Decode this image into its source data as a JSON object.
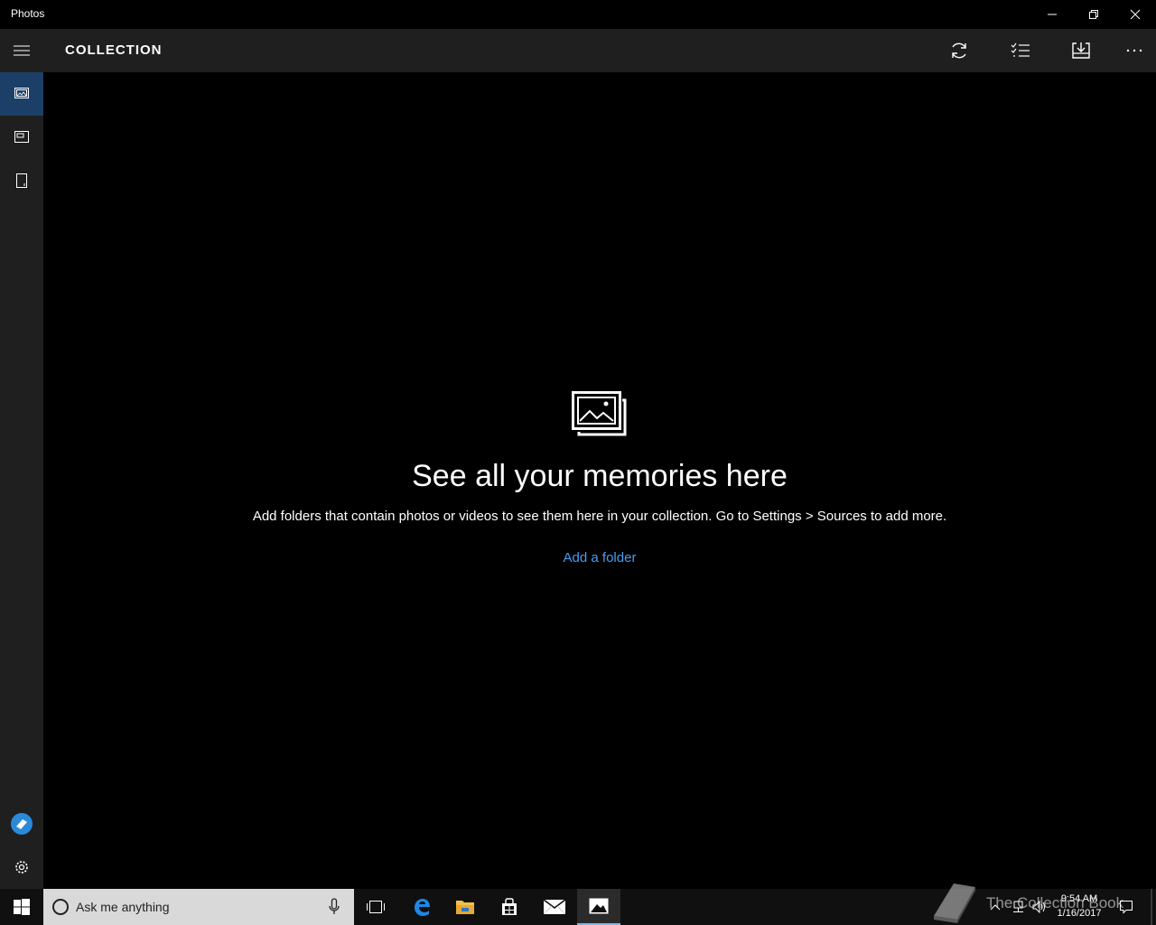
{
  "window": {
    "title": "Photos"
  },
  "header": {
    "title": "COLLECTION"
  },
  "empty_state": {
    "title": "See all your memories here",
    "description": "Add folders that contain photos or videos to see them here in your collection. Go to Settings > Sources to add more.",
    "link": "Add a folder"
  },
  "taskbar": {
    "search_placeholder": "Ask me anything",
    "time": "9:54 AM",
    "date": "1/16/2017"
  },
  "watermark": {
    "text": "The Collection Book"
  },
  "colors": {
    "accent": "#4a9df0",
    "active_nav": "#1b3f66",
    "rail_bg": "#1f1f1f"
  }
}
